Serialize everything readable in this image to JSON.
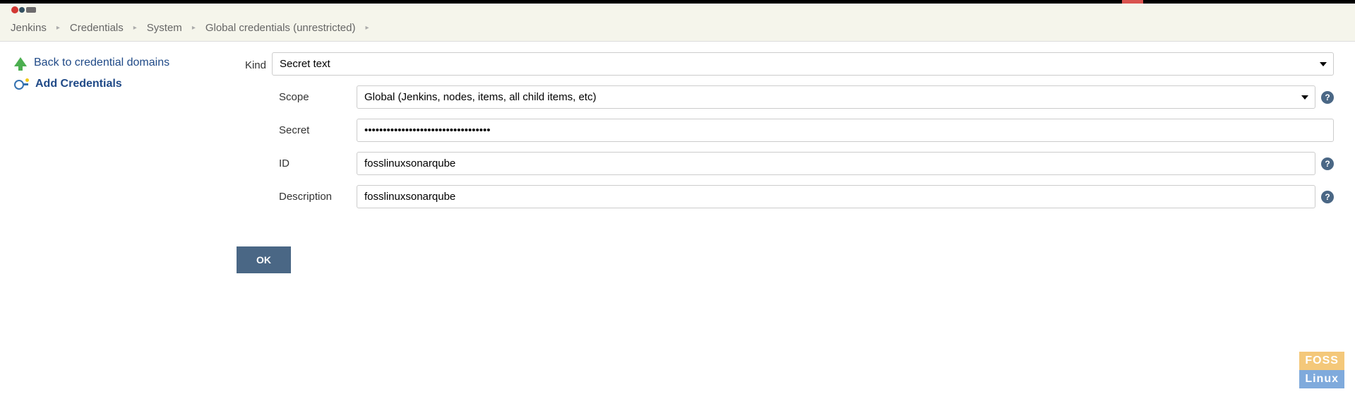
{
  "breadcrumb": {
    "items": [
      {
        "label": "Jenkins"
      },
      {
        "label": "Credentials"
      },
      {
        "label": "System"
      },
      {
        "label": "Global credentials (unrestricted)"
      }
    ]
  },
  "sidebar": {
    "back_label": "Back to credential domains",
    "add_label": "Add Credentials"
  },
  "form": {
    "kind_label": "Kind",
    "kind_value": "Secret text",
    "scope_label": "Scope",
    "scope_value": "Global (Jenkins, nodes, items, all child items, etc)",
    "secret_label": "Secret",
    "secret_value": "••••••••••••••••••••••••••••••••••",
    "id_label": "ID",
    "id_value": "fosslinuxsonarqube",
    "description_label": "Description",
    "description_value": "fosslinuxsonarqube",
    "ok_label": "OK"
  },
  "watermark": {
    "line1": "FOSS",
    "line2": "Linux"
  }
}
